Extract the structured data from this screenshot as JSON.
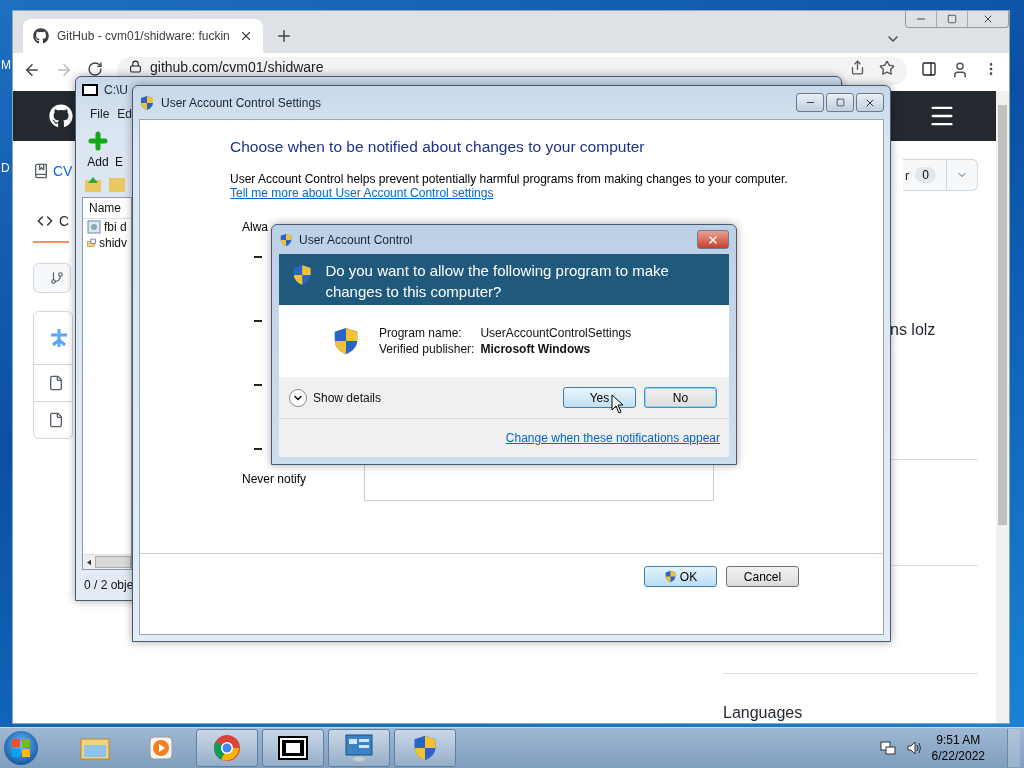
{
  "desktop": {
    "icons": [
      {
        "label": "M"
      },
      {
        "label": "D"
      }
    ]
  },
  "browser": {
    "tab": {
      "title": "GitHub - cvm01/shidware: fuckin",
      "selected": true
    },
    "url": "github.com/cvm01/shidware",
    "page": {
      "repo": "CV",
      "nav_tab": {
        "label": "C",
        "selected": true
      },
      "star_button": {
        "label": "r",
        "count": "0"
      },
      "about_text": "ns lolz",
      "section_heading": "Languages"
    }
  },
  "archive_window": {
    "title": "C:\\U",
    "menu": [
      "File",
      "Ed"
    ],
    "toolbar": [
      {
        "label": "Add",
        "kind": "add"
      },
      {
        "label": "E",
        "kind": "extract"
      }
    ],
    "column": "Name",
    "files": [
      {
        "name": "fbi d",
        "kind": "program"
      },
      {
        "name": "shidv",
        "kind": "archive"
      }
    ],
    "status": "0 / 2 obje"
  },
  "settings_window": {
    "title": "User Account Control Settings",
    "heading": "Choose when to be notified about changes to your computer",
    "description": "User Account Control helps prevent potentially harmful programs from making changes to your computer.",
    "link": "Tell me more about User Account Control settings",
    "slider": {
      "top_label": "Alwa",
      "bottom_label": "Never notify"
    },
    "buttons": [
      {
        "label": "OK",
        "kind": "default"
      },
      {
        "label": "Cancel",
        "kind": "normal"
      }
    ]
  },
  "dialog": {
    "title": "User Account Control",
    "question": "Do you want to allow the following program to make changes to this computer?",
    "program_label": "Program name:",
    "program": "UserAccountControlSettings",
    "publisher_label": "Verified publisher:",
    "publisher": "Microsoft Windows",
    "details": {
      "label": "Show details",
      "expanded": false
    },
    "buttons": [
      {
        "label": "Yes",
        "kind": "hovered"
      },
      {
        "label": "No",
        "kind": "focused"
      }
    ],
    "link": "Change when these notifications appear"
  },
  "taskbar": {
    "apps": [
      {
        "kind": "folder",
        "running": false
      },
      {
        "kind": "media",
        "running": false
      },
      {
        "kind": "browser",
        "running": true
      },
      {
        "kind": "archiver",
        "running": true
      },
      {
        "kind": "panel",
        "running": true
      },
      {
        "kind": "shield",
        "running": true
      }
    ],
    "time": "9:51 AM",
    "date": "6/22/2022"
  }
}
